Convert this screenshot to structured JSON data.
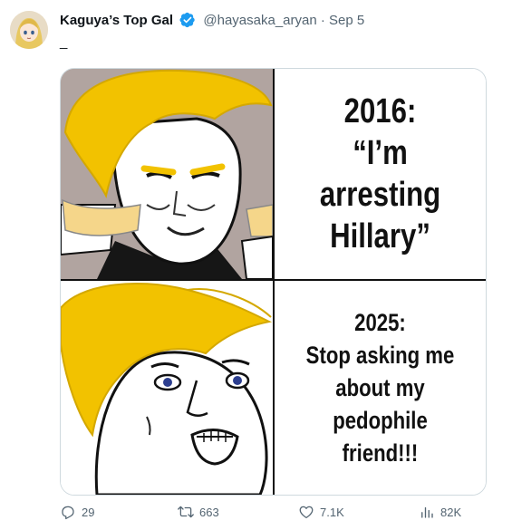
{
  "tweet": {
    "display_name": "Kaguya’s Top Gal",
    "handle": "@hayasaka_aryan",
    "separator": "·",
    "date": "Sep 5",
    "text": "_"
  },
  "meme": {
    "panel1": {
      "line1": "2016:",
      "line2": "“I’m",
      "line3": "arresting",
      "line4": "Hillary”"
    },
    "panel2": {
      "line1": "2025:",
      "line2": "Stop asking me",
      "line3": "about my",
      "line4": "pedophile",
      "line5": "friend!!!"
    }
  },
  "actions": {
    "replies": "29",
    "retweets": "663",
    "likes": "7.1K",
    "views": "82K"
  },
  "colors": {
    "accent_blue": "#1d9bf0",
    "muted_text": "#536471",
    "hair_yellow": "#f2c200"
  }
}
